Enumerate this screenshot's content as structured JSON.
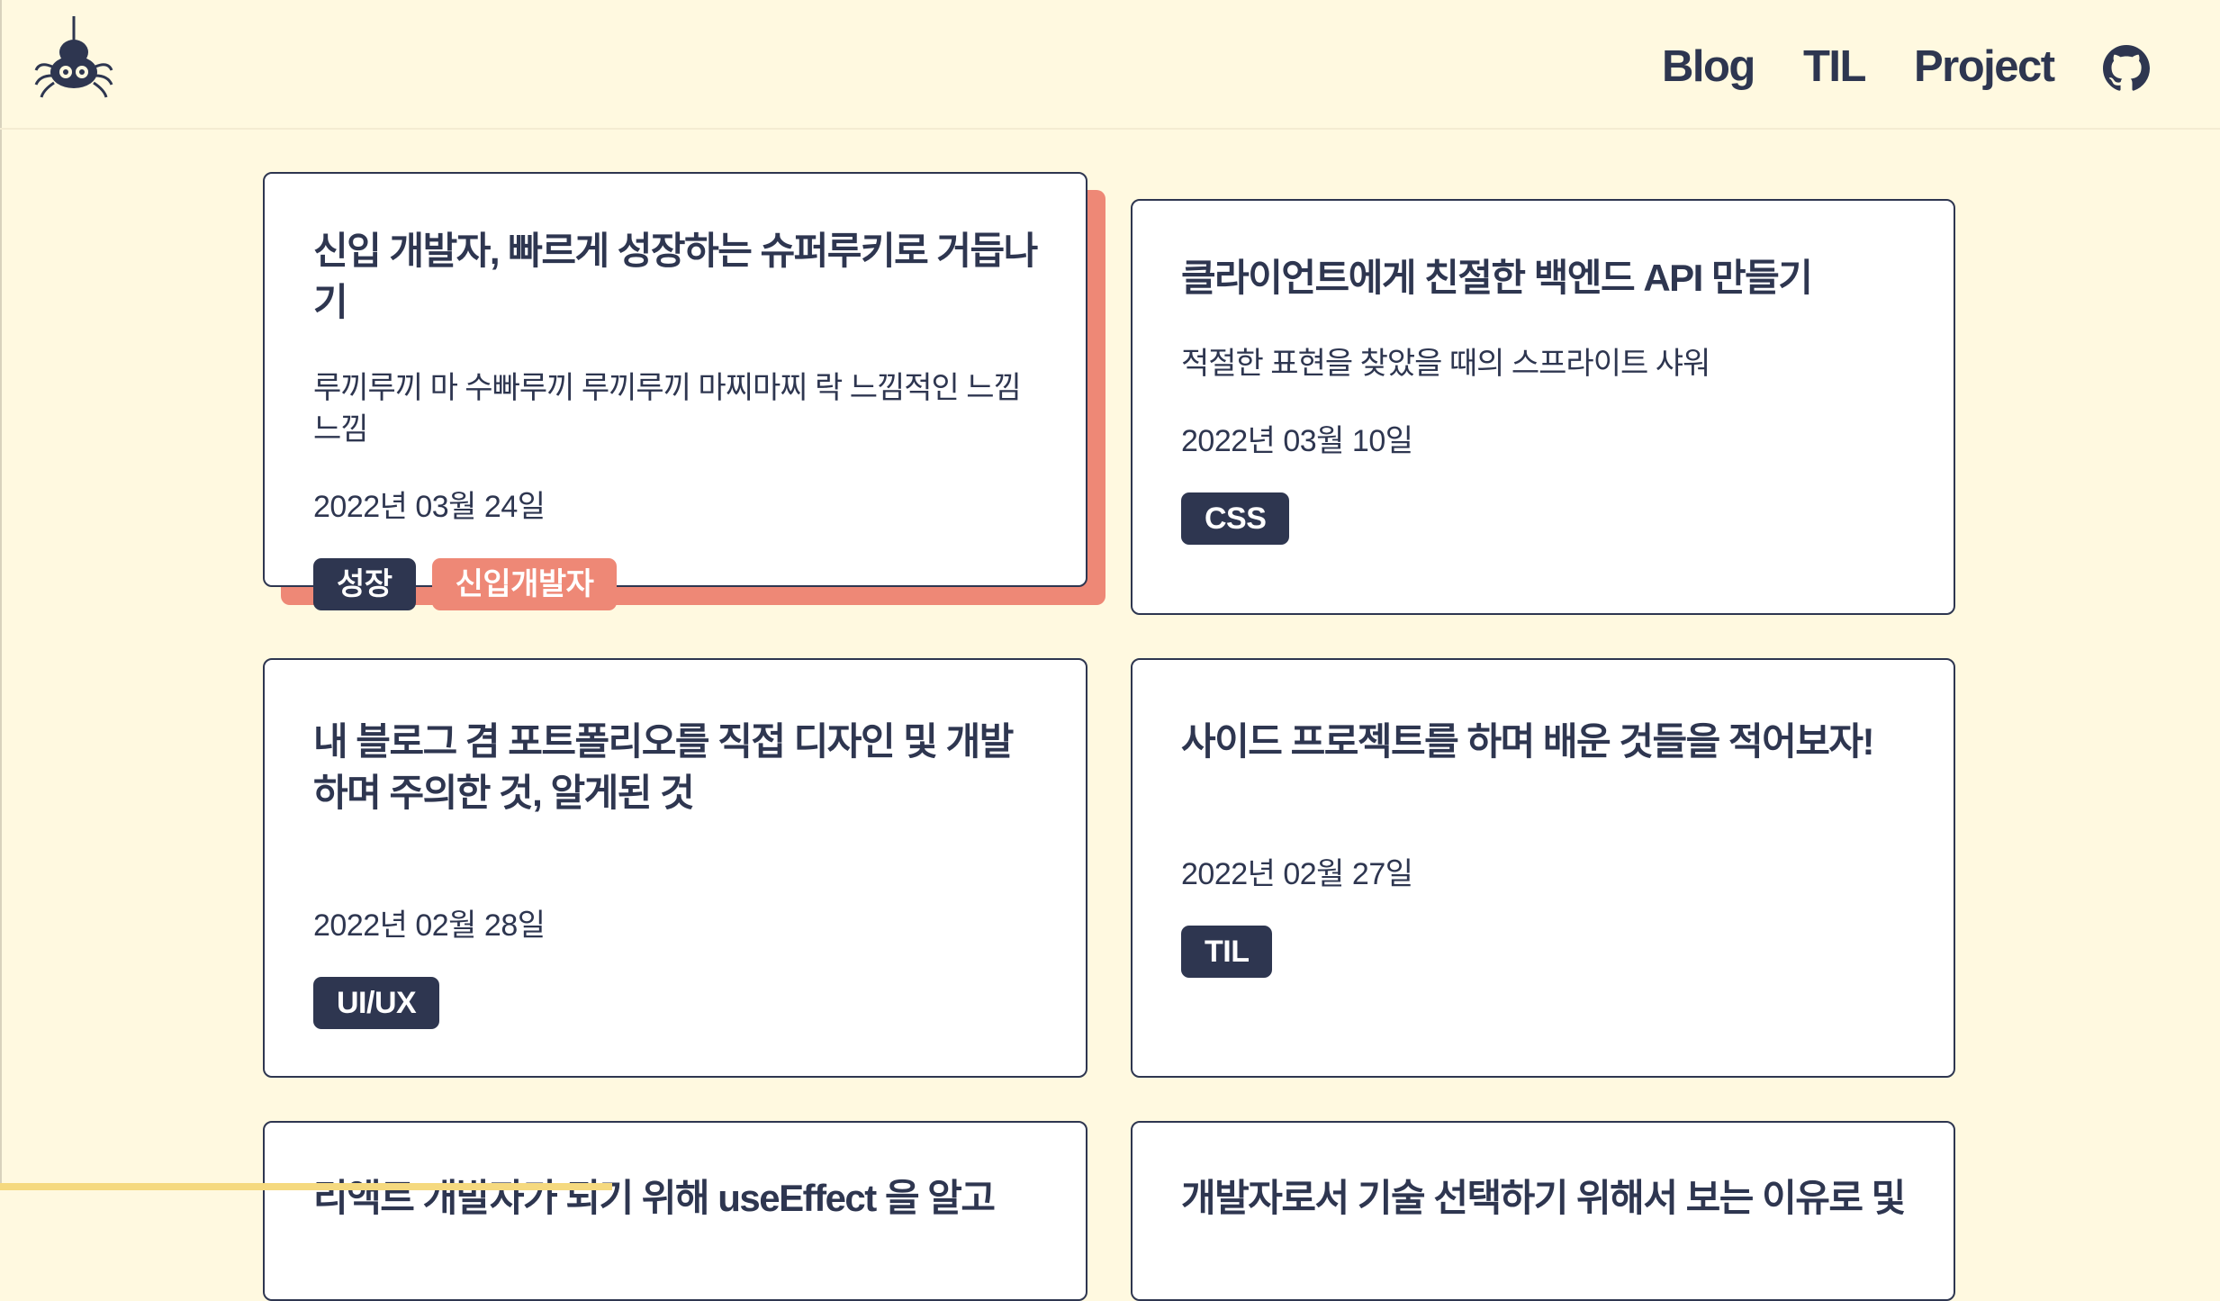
{
  "nav": {
    "logo_name": "spider-logo",
    "links": [
      {
        "label": "Blog"
      },
      {
        "label": "TIL"
      },
      {
        "label": "Project"
      }
    ],
    "github_icon": "github-icon"
  },
  "posts": [
    {
      "title": "신입 개발자, 빠르게 성장하는 슈퍼루키로 거듭나기",
      "description": "루끼루끼 마 수빠루끼 루끼루끼 마찌마찌 락 느낌적인 느낌느낌",
      "date": "2022년 03월 24일",
      "tags": [
        "성장",
        "신입개발자"
      ]
    },
    {
      "title": "클라이언트에게 친절한 백엔드 API 만들기",
      "description": "적절한 표현을 찾았을 때의 스프라이트 샤워",
      "date": "2022년 03월 10일",
      "tags": [
        "CSS"
      ]
    },
    {
      "title": "내 블로그 겸 포트폴리오를 직접 디자인 및 개발하며 주의한 것, 알게된 것",
      "date": "2022년 02월 28일",
      "tags": [
        "UI/UX"
      ]
    },
    {
      "title": "사이드 프로젝트를 하며 배운 것들을 적어보자!",
      "date": "2022년 02월 27일",
      "tags": [
        "TIL"
      ]
    },
    {
      "title": "리액트 개발자가 되기 위해 useEffect 을 알고",
      "date": "",
      "tags": []
    },
    {
      "title": "개발자로서 기술 선택하기 위해서 보는 이유로 및",
      "date": "",
      "tags": []
    }
  ],
  "colors": {
    "background": "#fff9e0",
    "navy": "#2e3650",
    "accent": "#ee8876"
  }
}
